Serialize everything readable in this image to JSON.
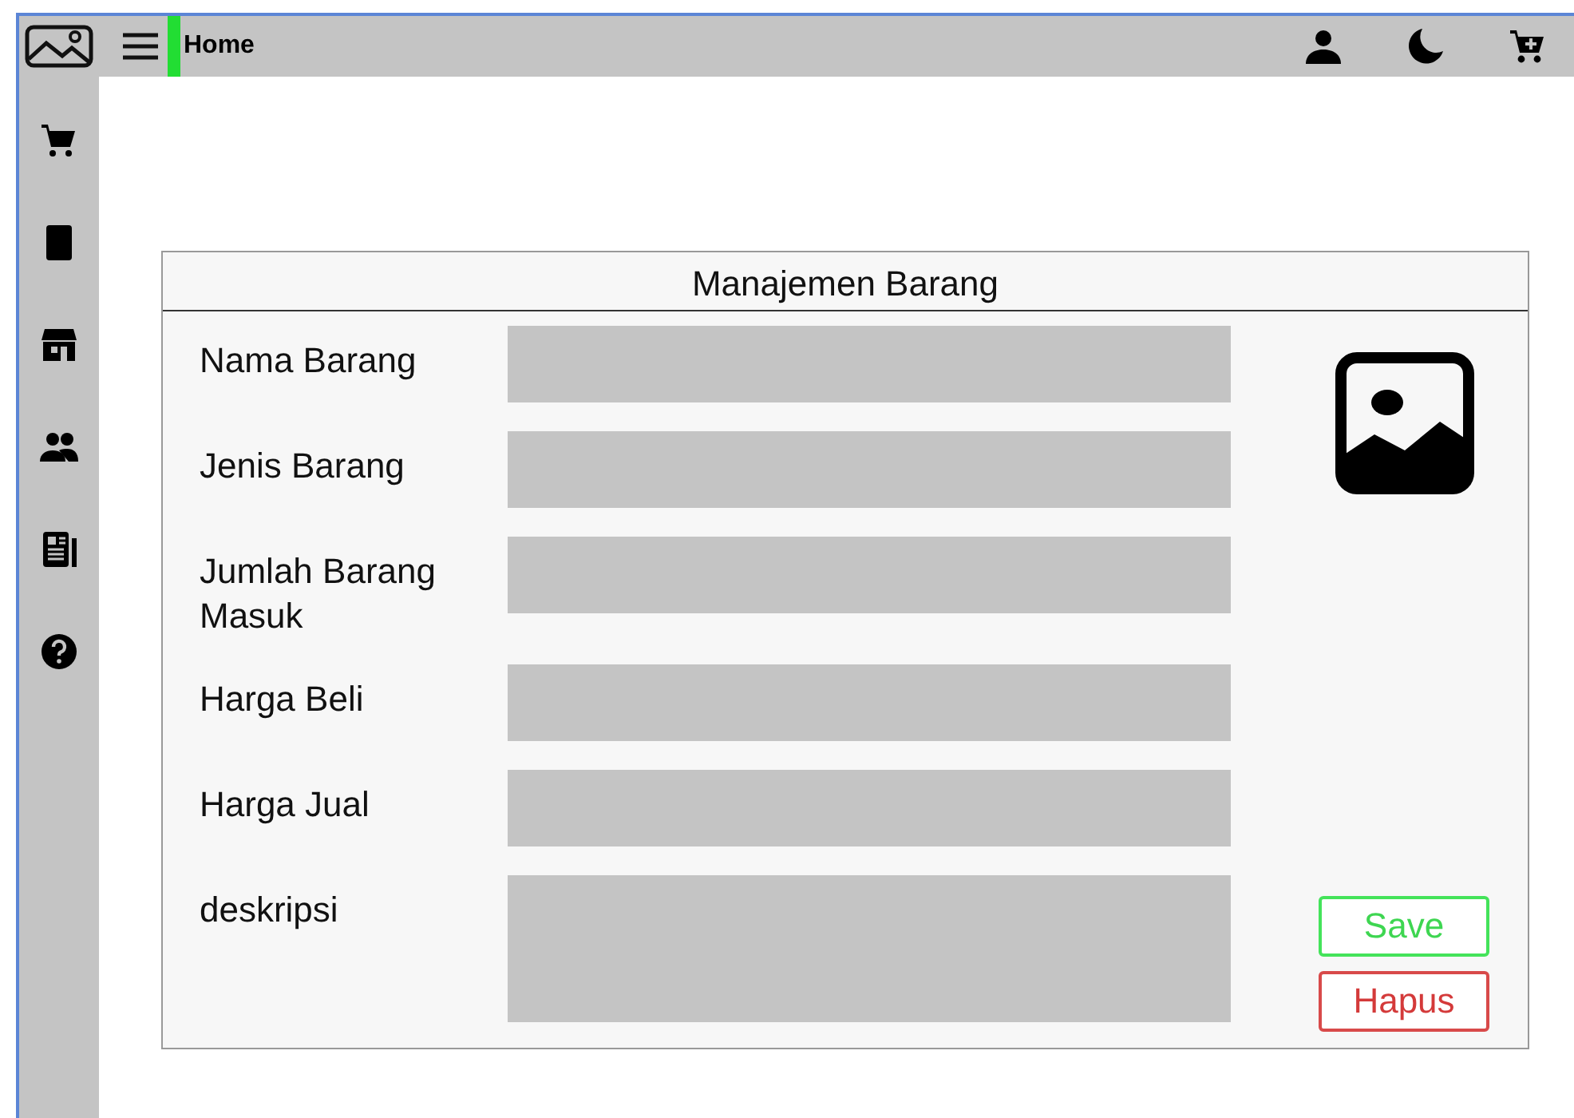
{
  "topbar": {
    "title": "Home"
  },
  "form": {
    "title": "Manajemen Barang",
    "fields": [
      {
        "label": "Nama Barang",
        "kind": "text"
      },
      {
        "label": "Jenis Barang",
        "kind": "text"
      },
      {
        "label": "Jumlah Barang\n Masuk",
        "kind": "text"
      },
      {
        "label": "Harga Beli",
        "kind": "text"
      },
      {
        "label": "Harga Jual",
        "kind": "text"
      },
      {
        "label": "deskripsi",
        "kind": "textarea"
      }
    ],
    "buttons": [
      {
        "label": "Save",
        "kind": "save"
      },
      {
        "label": "Hapus",
        "kind": "delete"
      }
    ]
  }
}
